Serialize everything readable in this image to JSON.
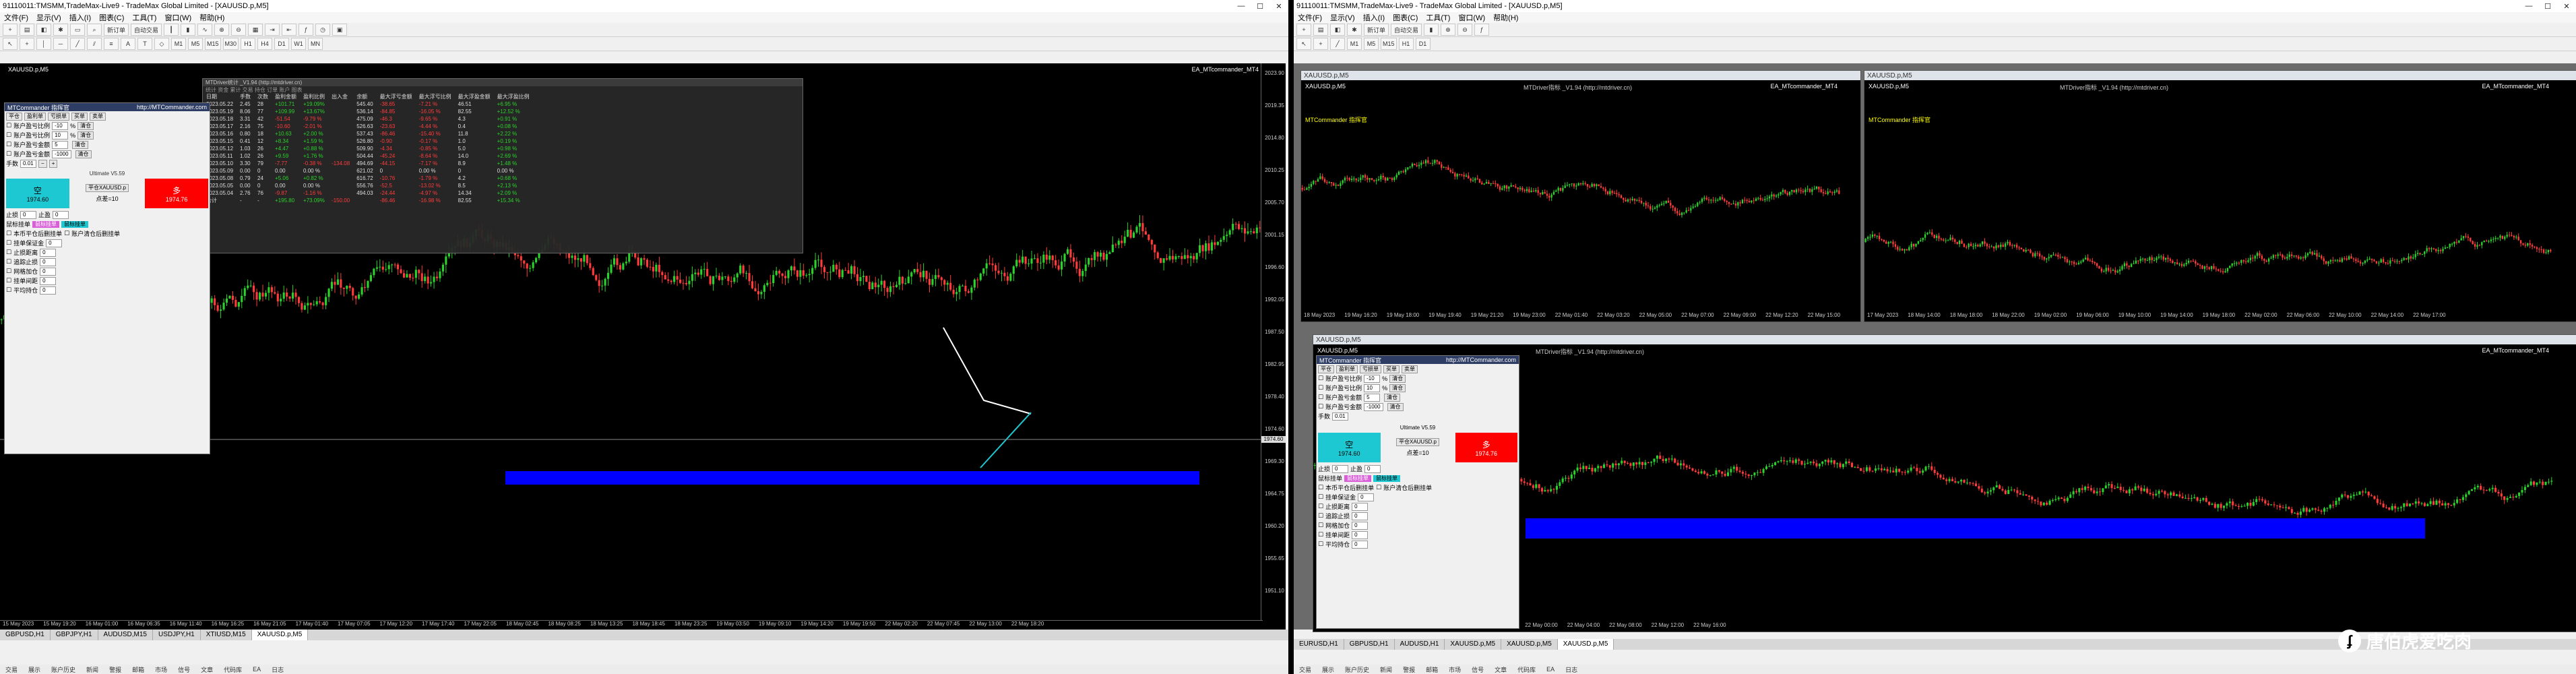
{
  "left": {
    "title": "91110011:TMSMM,TradeMax-Live9 - TradeMax Global Limited - [XAUUSD.p,M5]",
    "menu": [
      "文件(F)",
      "显示(V)",
      "插入(I)",
      "图表(C)",
      "工具(T)",
      "窗口(W)",
      "帮助(H)"
    ],
    "toolbar": {
      "new_order": "新订单",
      "algo": "自动交易",
      "periods": [
        "M1",
        "M5",
        "M15",
        "M30",
        "H1",
        "H4",
        "D1",
        "W1",
        "MN"
      ]
    },
    "chart": {
      "symbol_label": "XAUUSD.p,M5",
      "indicator_label": "MTDriver指标 _V1.94 (http://mtdriver.cn)",
      "ea_label": "EA_MTcommander_MT4",
      "y_ticks": [
        "2023.90",
        "2019.35",
        "2014.80",
        "2010.25",
        "2005.70",
        "2001.15",
        "1996.60",
        "1992.05",
        "1987.50",
        "1982.95",
        "1978.40",
        "1974.60",
        "1969.30",
        "1964.75",
        "1960.20",
        "1955.65",
        "1951.10"
      ],
      "price_box": "1974.60",
      "x_ticks": [
        "15 May 2023",
        "15 May 19:20",
        "16 May 01:00",
        "16 May 06:35",
        "16 May 11:40",
        "16 May 16:25",
        "16 May 21:05",
        "17 May 01:40",
        "17 May 07:05",
        "17 May 12:20",
        "17 May 17:40",
        "17 May 22:05",
        "18 May 02:45",
        "18 May 08:25",
        "18 May 13:25",
        "18 May 18:45",
        "18 May 23:25",
        "19 May 03:50",
        "19 May 09:10",
        "19 May 14:20",
        "19 May 19:50",
        "22 May 02:20",
        "22 May 07:45",
        "22 May 13:00",
        "22 May 18:20"
      ]
    },
    "stats": {
      "title": "MTDriver统计 _V1.94 (http://mtdriver.cn)",
      "menu": "统计 资金 累计  交易  持仓  订单  账户  图表",
      "headers": [
        "日期",
        "手数",
        "次数",
        "盈利金额",
        "盈利比例",
        "出入金",
        "余额",
        "最大浮亏金额",
        "最大浮亏比例",
        "最大浮盈金额",
        "最大浮盈比例"
      ],
      "rows": [
        [
          "2023.05.22",
          "2.45",
          "28",
          "+101.71",
          "+19.09%",
          "",
          "545.40",
          "-38.65",
          "-7.21 %",
          "46.51",
          "+6.95 %"
        ],
        [
          "2023.05.19",
          "8.06",
          "77",
          "+109.99",
          "+13.67%",
          "",
          "536.14",
          "-84.85",
          "-16.05 %",
          "82.55",
          "+12.52 %"
        ],
        [
          "2023.05.18",
          "3.31",
          "42",
          "-51.54",
          "-9.79 %",
          "",
          "475.09",
          "-46.3",
          "-9.65 %",
          "4.3",
          "+0.91 %"
        ],
        [
          "2023.05.17",
          "2.16",
          "75",
          "-10.60",
          "-2.01 %",
          "",
          "526.63",
          "-23.63",
          "-4.44 %",
          "0.4",
          "+0.08 %"
        ],
        [
          "2023.05.16",
          "0.80",
          "18",
          "+10.63",
          "+2.00 %",
          "",
          "537.43",
          "-86.46",
          "-15.40 %",
          "11.8",
          "+2.22 %"
        ],
        [
          "2023.05.15",
          "0.41",
          "12",
          "+8.34",
          "+1.59 %",
          "",
          "526.80",
          "-0.90",
          "-0.17 %",
          "1.0",
          "+0.19 %"
        ],
        [
          "2023.05.12",
          "1.03",
          "26",
          "+4.47",
          "+0.88 %",
          "",
          "509.90",
          "-4.34",
          "-0.85 %",
          "5.0",
          "+0.98 %"
        ],
        [
          "2023.05.11",
          "1.02",
          "26",
          "+9.59",
          "+1.76 %",
          "",
          "504.44",
          "-45.24",
          "-8.64 %",
          "14.0",
          "+2.69 %"
        ],
        [
          "2023.05.10",
          "3.30",
          "79",
          "-7.77",
          "-0.38 %",
          "-134.08",
          "494.69",
          "-44.15",
          "-7.17 %",
          "8.9",
          "+1.48 %"
        ],
        [
          "2023.05.09",
          "0.00",
          "0",
          "0.00",
          "0.00 %",
          "",
          "621.02",
          "0",
          "0.00 %",
          "0",
          "0.00 %"
        ],
        [
          "2023.05.08",
          "0.79",
          "24",
          "+5.06",
          "+0.82 %",
          "",
          "616.72",
          "-10.76",
          "-1.79 %",
          "4.2",
          "+0.68 %"
        ],
        [
          "2023.05.05",
          "0.00",
          "0",
          "0.00",
          "0.00 %",
          "",
          "556.76",
          "-52.5",
          "-13.02 %",
          "8.5",
          "+2.13 %"
        ],
        [
          "2023.05.04",
          "2.76",
          "76",
          "-9.87",
          "-1.16 %",
          "",
          "494.03",
          "-24.44",
          "-4.97 %",
          "14.34",
          "+2.09 %"
        ],
        [
          "合计",
          "-",
          "-",
          "+195.80",
          "+73.09%",
          "-150.00",
          "",
          "-86.46",
          "-16.98 %",
          "82.55",
          "+15.34 %"
        ]
      ]
    },
    "panel": {
      "title": "MTCommander 指挥官",
      "url": "http://MTCommander.com",
      "top_buttons": [
        "平仓",
        "盈利单",
        "亏损单",
        "买单",
        "卖单"
      ],
      "rows": [
        {
          "label": "账户盈亏比例",
          "val": "-10",
          "unit": "%",
          "chk": "清仓"
        },
        {
          "label": "账户盈亏比例",
          "val": "10",
          "unit": "%",
          "chk": "清仓"
        },
        {
          "label": "账户盈亏金额",
          "val": "5",
          "unit": "",
          "chk": "清仓"
        },
        {
          "label": "账户盈亏金额",
          "val": "-1000",
          "unit": "",
          "chk": "清仓"
        }
      ],
      "lots_label": "手数",
      "lots_val": "0.01",
      "sell_label": "空",
      "sell_price": "1974.60",
      "buy_label": "多",
      "buy_price": "1974.76",
      "mid_label": "平仓XAUUSD.p",
      "spread": "点差=10",
      "version": "Ultimate V5.59",
      "stop_label": "止损",
      "take_label": "止盈",
      "section1": "鼠标挂单",
      "purple_btn": "鼠标挂单",
      "cyan_btn": "鼠标挂单",
      "checks": [
        "本币平仓后删挂单",
        "账户清仓后删挂单"
      ],
      "bottom_rows": [
        "挂单保证金",
        "止损距离",
        "追踪止损",
        "网格加仓",
        "挂单间距",
        "平均持仓"
      ]
    },
    "tabs": [
      "GBPUSD,H1",
      "GBPJPY,H1",
      "AUDUSD,M15",
      "USDJPY,H1",
      "XTIUSD,M15",
      "XAUUSD.p,M5"
    ],
    "active_tab": "XAUUSD.p,M5",
    "status": [
      "交易",
      "展示",
      "账户历史",
      "新闻",
      "警报",
      "邮箱",
      "市场",
      "信号",
      "文章",
      "代码库",
      "EA",
      "日志"
    ]
  },
  "right": {
    "title": "91110011:TMSMM,TradeMax-Live9 - TradeMax Global Limited - [XAUUSD.p,M5]",
    "menu": [
      "文件(F)",
      "显示(V)",
      "插入(I)",
      "图表(C)",
      "工具(T)",
      "窗口(W)",
      "帮助(H)"
    ],
    "win_a": {
      "title": "XAUUSD.p,M5",
      "symbol": "XAUUSD.p,M5",
      "label": "MTCommander 指挥官",
      "indicator": "MTDriver指标 _V1.94 (http://mtdriver.cn)",
      "ea": "EA_MTcommander_MT4",
      "x_ticks": [
        "18 May 2023",
        "19 May 16:20",
        "19 May 18:00",
        "19 May 19:40",
        "19 May 21:20",
        "19 May 23:00",
        "22 May 01:40",
        "22 May 03:20",
        "22 May 05:00",
        "22 May 07:00",
        "22 May 09:00",
        "22 May 12:20",
        "22 May 15:00",
        "22 May 17:40"
      ]
    },
    "win_b": {
      "title": "XAUUSD.p,M5",
      "symbol": "XAUUSD.p,M5",
      "label": "MTCommander 指挥官",
      "indicator": "MTDriver指标 _V1.94 (http://mtdriver.cn)",
      "ea": "EA_MTcommander_MT4",
      "x_ticks": [
        "17 May 2023",
        "18 May 14:00",
        "18 May 18:00",
        "18 May 22:00",
        "19 May 02:00",
        "19 May 06:00",
        "19 May 10:00",
        "19 May 14:00",
        "19 May 18:00",
        "22 May 02:00",
        "22 May 06:00",
        "22 May 10:00",
        "22 May 14:00",
        "22 May 17:00"
      ]
    },
    "win_c": {
      "title": "XAUUSD.p,M5",
      "symbol": "XAUUSD.p,M5",
      "indicator": "MTDriver指标 _V1.94 (http://mtdriver.cn)",
      "ea": "EA_MTcommander_MT4",
      "x_ticks": [
        "18 May 2023",
        "19 May 08:40",
        "19 May 12:00",
        "19 May 16:00",
        "19 May 20:00",
        "22 May 00:00",
        "22 May 04:00",
        "22 May 08:00",
        "22 May 12:00",
        "22 May 16:00"
      ]
    },
    "tabs": [
      "EURUSD,H1",
      "GBPUSD,H1",
      "AUDUSD,H1",
      "XAUUSD.p,M5",
      "XAUUSD.p,M5",
      "XAUUSD.p,M5"
    ],
    "active_tab": "XAUUSD.p,M5",
    "status": [
      "交易",
      "展示",
      "账户历史",
      "新闻",
      "警报",
      "邮箱",
      "市场",
      "信号",
      "文章",
      "代码库",
      "EA",
      "日志"
    ]
  },
  "watermark": "唐伯虎爱吃肉",
  "colors": {
    "up": "#2bd22b",
    "down": "#ff3b3b",
    "band": "#0000ff",
    "sell": "#1ec8d2",
    "buy": "#ff0000"
  }
}
